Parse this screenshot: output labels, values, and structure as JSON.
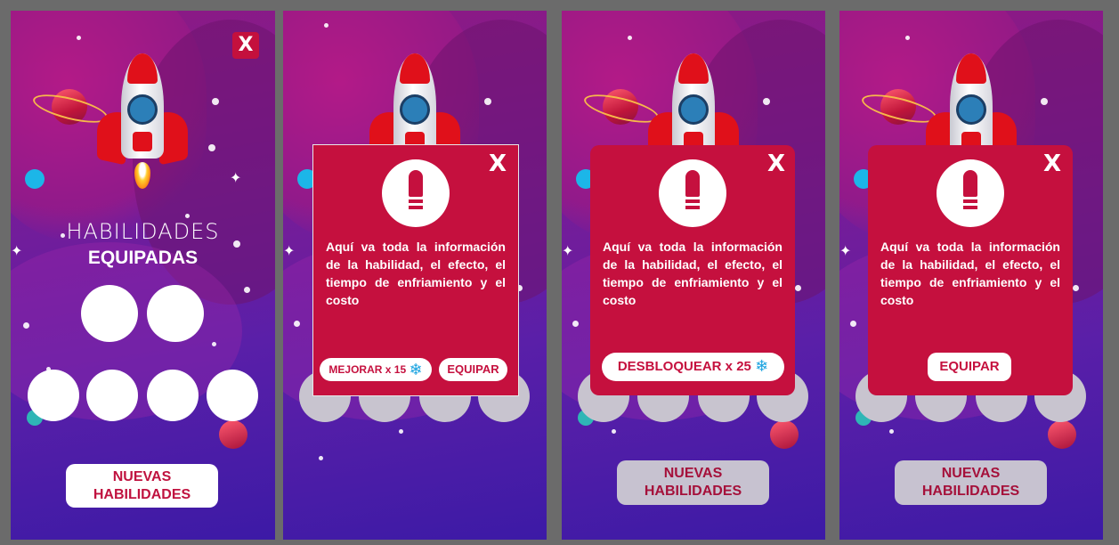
{
  "screens": [
    {
      "title_line1": "HABILIDADES",
      "title_line2": "EQUIPADAS",
      "close_label": "X",
      "button_line1": "NUEVAS",
      "button_line2": "HABILIDADES"
    },
    {
      "close_label": "X",
      "message": "Aquí va toda la información de la habilidad, el efecto, el tiempo de enfriamiento y el costo",
      "upgrade_label": "MEJORAR x 15",
      "equip_label": "EQUIPAR",
      "currency_icon": "snowflake-icon"
    },
    {
      "close_label": "X",
      "message": "Aquí va toda la información de la habilidad, el efecto, el tiempo de enfriamiento y el costo",
      "unlock_label": "DESBLOQUEAR x 25",
      "currency_icon": "snowflake-icon",
      "button_line1": "NUEVAS",
      "button_line2": "HABILIDADES"
    },
    {
      "close_label": "X",
      "message": "Aquí va toda la información de la habilidad, el efecto, el tiempo de enfriamiento y el costo",
      "equip_label": "EQUIPAR",
      "button_line1": "NUEVAS",
      "button_line2": "HABILIDADES"
    }
  ],
  "colors": {
    "modal": "#c5103e",
    "accent_text": "#c0123f",
    "currency": "#1aa3e0",
    "background_top": "#8e1a82",
    "background_bottom": "#3c1aa6"
  }
}
